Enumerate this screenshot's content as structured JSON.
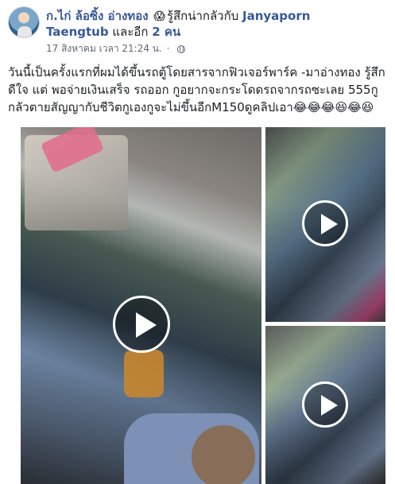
{
  "header": {
    "author": "ก.ไก่ ล้อซิ้ง อ่างทอง",
    "feeling_emoji": "😱",
    "feeling": "รู้สึกน่ากลัวกับ",
    "tagged_name": "Janyaporn",
    "tagged_line2": "Taengtub",
    "and_others_prefix": "และอีก",
    "and_others_link": "2 คน",
    "timestamp": "17 สิงหาคม เวลา 21:24 น.",
    "privacy_icon": "globe-icon"
  },
  "post": {
    "text": "วันนี้เป็นครั้งแรกที่ผมได้ขึ้นรถตู้โดยสารจากฟิวเจอร์พาร์ค -มาอ่างทอง รู้สึกดีใจ แต่ พอจ่ายเงินเสร็จ รถออก กูอยากจะกระโดดรถจากรถซะเลย 555กูกลัวตายสัญญากับชีวิตกูเองกูจะไม่ขึ้นอีกM150ดูคลิปเอา😂😂😂😆😂😆"
  },
  "media": {
    "videos": [
      {
        "label": "video-1",
        "icon": "play-icon"
      },
      {
        "label": "video-2",
        "icon": "play-icon"
      },
      {
        "label": "video-3",
        "icon": "play-icon"
      }
    ]
  }
}
